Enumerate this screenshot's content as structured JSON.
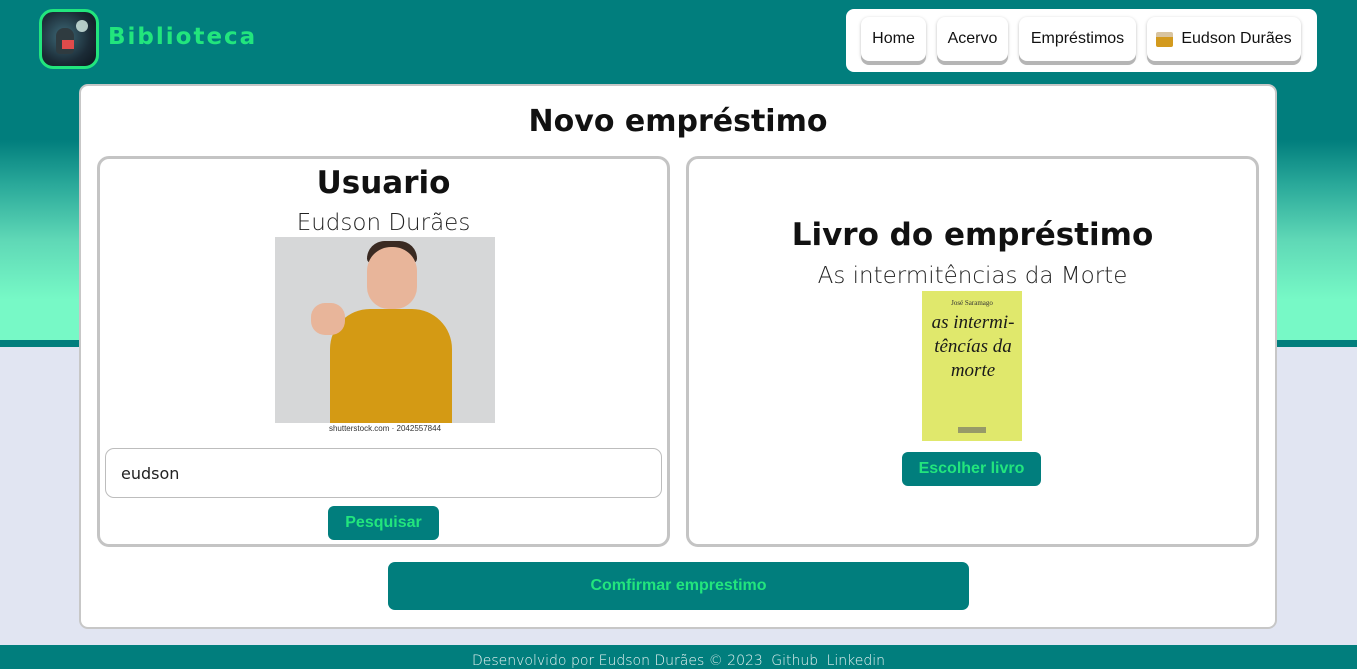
{
  "app": {
    "brand": "Biblioteca"
  },
  "nav": {
    "items": [
      {
        "label": "Home"
      },
      {
        "label": "Acervo"
      },
      {
        "label": "Empréstimos"
      },
      {
        "label": "Eudson Durães"
      }
    ]
  },
  "page": {
    "title": "Novo empréstimo"
  },
  "user_panel": {
    "heading": "Usuario",
    "name": "Eudson Durães",
    "photo_caption": "shutterstock.com · 2042557844",
    "search": {
      "value": "eudson",
      "placeholder": ""
    },
    "search_button": "Pesquisar"
  },
  "book_panel": {
    "heading": "Livro do empréstimo",
    "book_title": "As intermitências da Morte",
    "cover": {
      "author": "José Saramago",
      "title": "as intermi-têncías da morte"
    },
    "choose_button": "Escolher livro"
  },
  "confirm_button": "Comfirmar emprestimo",
  "footer": {
    "text": "Desenvolvido por Eudson Durães © 2023",
    "links": [
      "Github",
      "Linkedin"
    ]
  },
  "colors": {
    "teal": "#017e7d",
    "accent_green": "#22e57d",
    "mint": "#77f9c6",
    "page_bg": "#e1e5f2"
  }
}
